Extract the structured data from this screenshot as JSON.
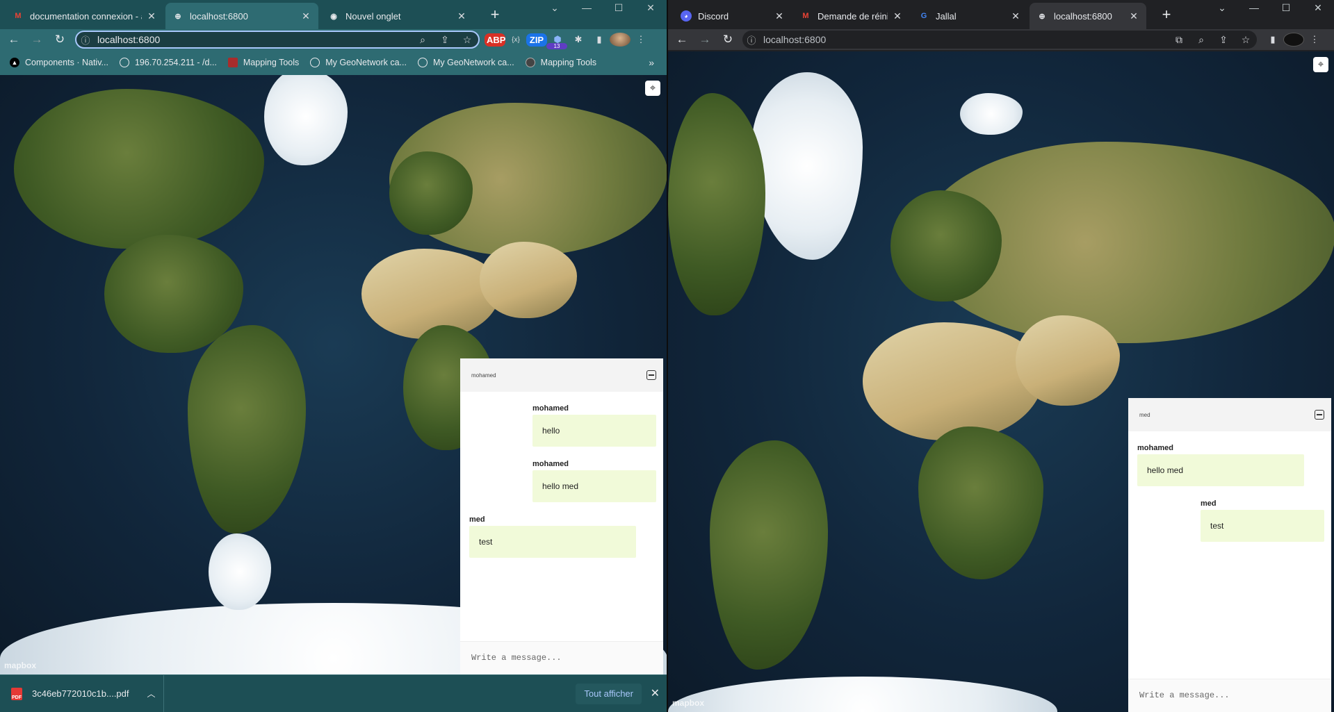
{
  "left": {
    "tabs": [
      {
        "title": "documentation connexion - ar",
        "icon": "gmail-icon",
        "active": false
      },
      {
        "title": "localhost:6800",
        "icon": "globe-icon",
        "active": true
      },
      {
        "title": "Nouvel onglet",
        "icon": "chrome-icon",
        "active": false
      }
    ],
    "url": "localhost:6800",
    "extension_badge": "13",
    "bookmarks": [
      {
        "label": "Components · Nativ..."
      },
      {
        "label": "196.70.254.211 - /d..."
      },
      {
        "label": "Mapping Tools"
      },
      {
        "label": "My GeoNetwork ca..."
      },
      {
        "label": "My GeoNetwork ca..."
      },
      {
        "label": "Mapping Tools"
      }
    ],
    "chat": {
      "username": "mohamed",
      "messages": [
        {
          "sender": "mohamed",
          "text": "hello",
          "own": true
        },
        {
          "sender": "mohamed",
          "text": "hello med",
          "own": true
        },
        {
          "sender": "med",
          "text": "test",
          "own": false
        }
      ],
      "input_placeholder": "Write a message..."
    },
    "map_logo": "mapbox",
    "downloads": {
      "file": "3c46eb772010c1b....pdf",
      "show_all": "Tout afficher"
    }
  },
  "right": {
    "tabs": [
      {
        "title": "Discord",
        "icon": "discord-icon",
        "active": false
      },
      {
        "title": "Demande de réiniti",
        "icon": "gmail-icon",
        "active": false
      },
      {
        "title": "Jallal",
        "icon": "google-icon",
        "active": false
      },
      {
        "title": "localhost:6800",
        "icon": "globe-icon",
        "active": true
      }
    ],
    "url": "localhost:6800",
    "chat": {
      "username": "med",
      "messages": [
        {
          "sender": "mohamed",
          "text": "hello med",
          "own": false
        },
        {
          "sender": "med",
          "text": "test",
          "own": true
        }
      ],
      "input_placeholder": "Write a message..."
    },
    "map_logo": "mapbox"
  },
  "colors": {
    "left_frame": "#1d4f55",
    "right_frame": "#202124",
    "bubble": "#f1fad9"
  }
}
